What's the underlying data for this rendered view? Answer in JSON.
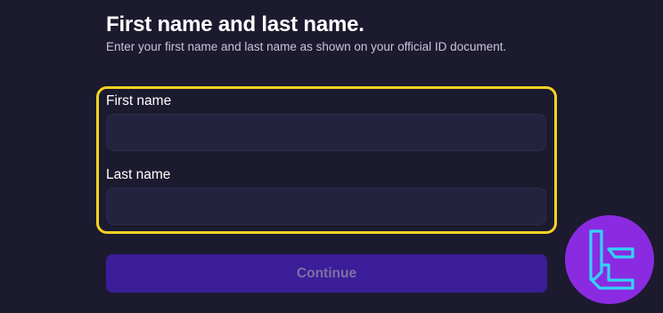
{
  "form": {
    "title": "First name and last name.",
    "subtitle": "Enter your first name and last name as shown on your official ID document.",
    "first_name": {
      "label": "First name",
      "value": "",
      "placeholder": ""
    },
    "last_name": {
      "label": "Last name",
      "value": "",
      "placeholder": ""
    },
    "continue_label": "Continue"
  },
  "logo": {
    "icon": "tc-brand-logo-icon"
  },
  "colors": {
    "background": "#1c1a2e",
    "input_background": "#25223f",
    "highlight_border": "#f5d323",
    "button_background": "#3c1d99",
    "button_text": "#7a72a3",
    "logo_background": "#8a2be2",
    "logo_stroke": "#33d3f5"
  }
}
